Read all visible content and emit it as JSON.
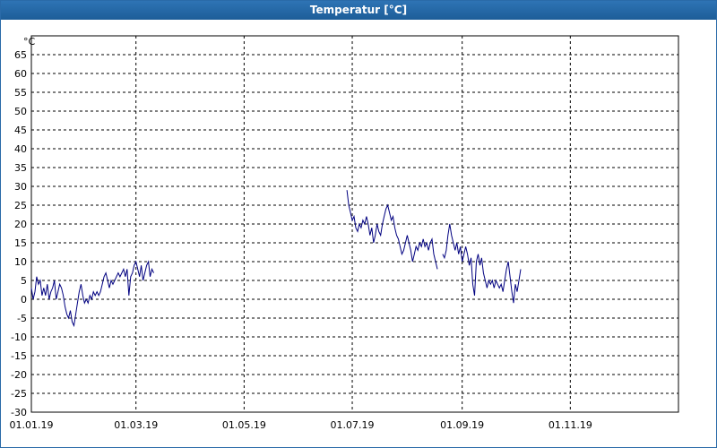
{
  "window": {
    "title": "Temperatur [°C]"
  },
  "chart_data": {
    "type": "line",
    "title": "Temperatur [°C]",
    "ylabel": "°C",
    "xlabel": "",
    "ylim": [
      -30,
      70
    ],
    "y_ticks": [
      65,
      60,
      55,
      50,
      45,
      40,
      35,
      30,
      25,
      20,
      15,
      10,
      5,
      0,
      -5,
      -10,
      -15,
      -20,
      -25,
      -30
    ],
    "x_ticks": [
      {
        "label": "01.01.19",
        "day": 0
      },
      {
        "label": "01.03.19",
        "day": 59
      },
      {
        "label": "01.05.19",
        "day": 120
      },
      {
        "label": "01.07.19",
        "day": 181
      },
      {
        "label": "01.09.19",
        "day": 243
      },
      {
        "label": "01.11.19",
        "day": 304
      }
    ],
    "xlim_day": [
      0,
      365
    ],
    "grid": true,
    "series": [
      {
        "color": "#000080",
        "segments": [
          [
            [
              0,
              3
            ],
            [
              1,
              0
            ],
            [
              2,
              2
            ],
            [
              3,
              6
            ],
            [
              4,
              4
            ],
            [
              5,
              5
            ],
            [
              6,
              1
            ],
            [
              7,
              3
            ],
            [
              8,
              1
            ],
            [
              9,
              4
            ],
            [
              10,
              0
            ],
            [
              11,
              2
            ],
            [
              12,
              3
            ],
            [
              13,
              5
            ],
            [
              14,
              0
            ],
            [
              15,
              2
            ],
            [
              16,
              4
            ],
            [
              17,
              3
            ],
            [
              18,
              1
            ],
            [
              19,
              -2
            ],
            [
              20,
              -4
            ],
            [
              21,
              -5
            ],
            [
              22,
              -3
            ],
            [
              23,
              -6
            ],
            [
              24,
              -7
            ],
            [
              25,
              -4
            ],
            [
              26,
              -1
            ],
            [
              27,
              2
            ],
            [
              28,
              4
            ],
            [
              29,
              1
            ],
            [
              30,
              -1
            ],
            [
              31,
              0
            ],
            [
              32,
              -1
            ],
            [
              33,
              1
            ],
            [
              34,
              0
            ],
            [
              35,
              2
            ],
            [
              36,
              1
            ],
            [
              37,
              2
            ],
            [
              38,
              1
            ],
            [
              39,
              2
            ],
            [
              40,
              4
            ],
            [
              41,
              6
            ],
            [
              42,
              7
            ],
            [
              43,
              5
            ],
            [
              44,
              3
            ],
            [
              45,
              5
            ],
            [
              46,
              4
            ],
            [
              47,
              5
            ],
            [
              48,
              6
            ],
            [
              49,
              7
            ],
            [
              50,
              6
            ],
            [
              51,
              7
            ],
            [
              52,
              8
            ],
            [
              53,
              6
            ],
            [
              54,
              8
            ],
            [
              55,
              1
            ],
            [
              56,
              6
            ],
            [
              57,
              7
            ],
            [
              58,
              9
            ],
            [
              59,
              10
            ],
            [
              60,
              8
            ],
            [
              61,
              6
            ],
            [
              62,
              9
            ],
            [
              63,
              5
            ],
            [
              64,
              7
            ],
            [
              65,
              9
            ],
            [
              66,
              10
            ],
            [
              67,
              6
            ],
            [
              68,
              8
            ],
            [
              69,
              7
            ]
          ],
          [
            [
              178,
              29
            ],
            [
              179,
              25
            ],
            [
              180,
              23
            ],
            [
              181,
              21
            ],
            [
              182,
              22
            ],
            [
              183,
              19
            ],
            [
              184,
              18
            ],
            [
              185,
              20
            ],
            [
              186,
              19
            ],
            [
              187,
              21
            ],
            [
              188,
              20
            ],
            [
              189,
              22
            ],
            [
              190,
              20
            ],
            [
              191,
              17
            ],
            [
              192,
              19
            ],
            [
              193,
              15
            ],
            [
              194,
              17
            ],
            [
              195,
              20
            ],
            [
              196,
              18
            ],
            [
              197,
              17
            ],
            [
              198,
              20
            ],
            [
              199,
              22
            ],
            [
              200,
              24
            ],
            [
              201,
              25
            ],
            [
              202,
              23
            ],
            [
              203,
              21
            ],
            [
              204,
              22
            ],
            [
              205,
              19
            ],
            [
              206,
              17
            ],
            [
              207,
              16
            ],
            [
              208,
              14
            ],
            [
              209,
              12
            ],
            [
              210,
              13
            ],
            [
              211,
              15
            ],
            [
              212,
              17
            ],
            [
              213,
              15
            ],
            [
              214,
              13
            ],
            [
              215,
              10
            ],
            [
              216,
              12
            ],
            [
              217,
              14
            ],
            [
              218,
              13
            ],
            [
              219,
              15
            ],
            [
              220,
              14
            ],
            [
              221,
              16
            ],
            [
              222,
              14
            ],
            [
              223,
              15
            ],
            [
              224,
              13
            ],
            [
              225,
              15
            ],
            [
              226,
              16
            ],
            [
              227,
              12
            ],
            [
              228,
              10
            ],
            [
              229,
              8
            ]
          ],
          [
            [
              232,
              12
            ],
            [
              233,
              11
            ],
            [
              234,
              13
            ],
            [
              235,
              17
            ],
            [
              236,
              20
            ],
            [
              237,
              17
            ],
            [
              238,
              15
            ],
            [
              239,
              13
            ],
            [
              240,
              15
            ],
            [
              241,
              12
            ],
            [
              242,
              14
            ],
            [
              243,
              10
            ],
            [
              244,
              12
            ],
            [
              245,
              14
            ],
            [
              246,
              12
            ],
            [
              247,
              9
            ],
            [
              248,
              11
            ],
            [
              249,
              4
            ],
            [
              250,
              1
            ],
            [
              251,
              10
            ],
            [
              252,
              12
            ],
            [
              253,
              9
            ],
            [
              254,
              11
            ],
            [
              255,
              7
            ],
            [
              256,
              5
            ],
            [
              257,
              3
            ],
            [
              258,
              5
            ],
            [
              259,
              4
            ],
            [
              260,
              5
            ],
            [
              261,
              3
            ],
            [
              262,
              5
            ],
            [
              263,
              4
            ],
            [
              264,
              3
            ],
            [
              265,
              4
            ],
            [
              266,
              2
            ],
            [
              267,
              5
            ],
            [
              268,
              8
            ],
            [
              269,
              10
            ],
            [
              270,
              6
            ],
            [
              271,
              2
            ],
            [
              272,
              -1
            ],
            [
              273,
              4
            ],
            [
              274,
              2
            ],
            [
              275,
              5
            ],
            [
              276,
              8
            ]
          ]
        ]
      }
    ]
  }
}
